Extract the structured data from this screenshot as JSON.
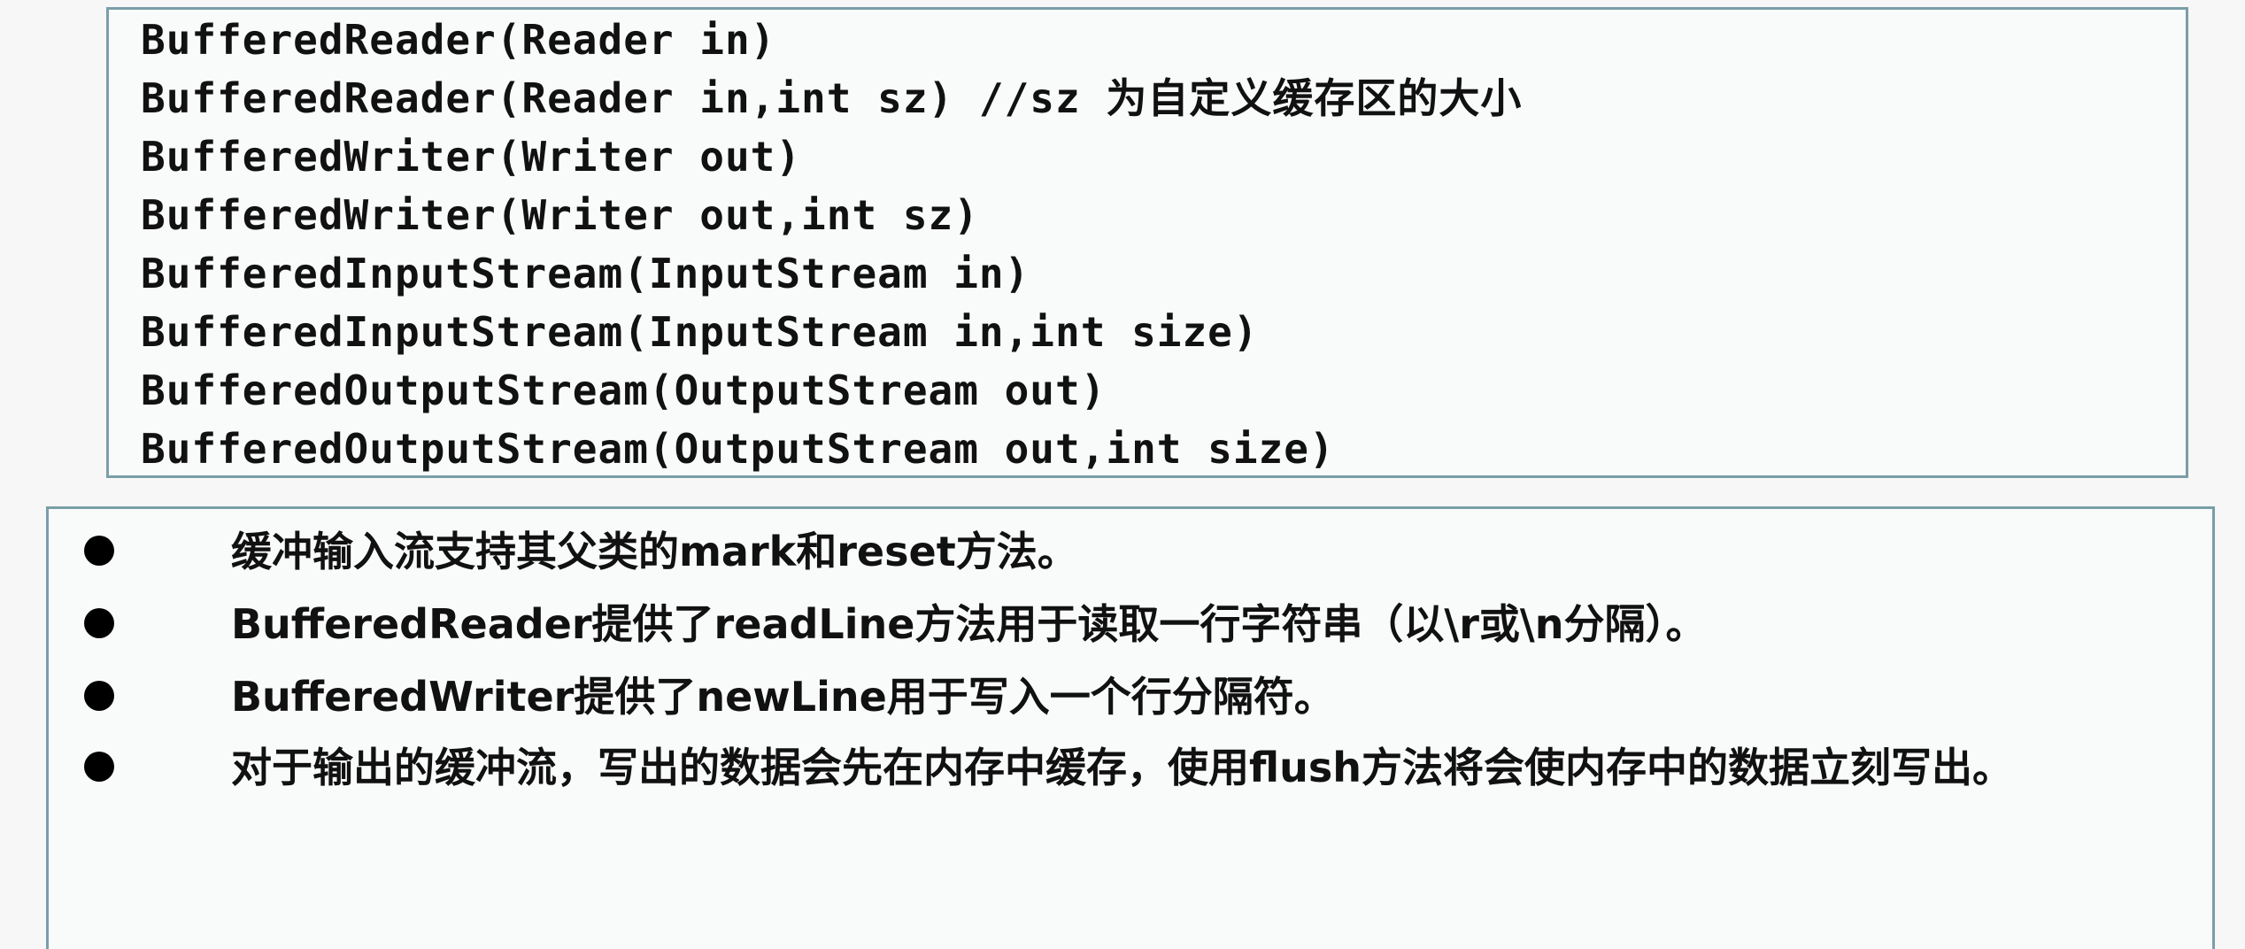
{
  "code_lines": [
    "BufferedReader(Reader in)",
    "BufferedReader(Reader in,int sz) //sz 为自定义缓存区的大小",
    "BufferedWriter(Writer out)",
    "BufferedWriter(Writer out,int sz)",
    "BufferedInputStream(InputStream in)",
    "BufferedInputStream(InputStream in,int size)",
    "BufferedOutputStream(OutputStream out)",
    "BufferedOutputStream(OutputStream out,int size)"
  ],
  "notes": [
    "缓冲输入流支持其父类的mark和reset方法。",
    "BufferedReader提供了readLine方法用于读取一行字符串（以\\r或\\n分隔）。",
    "BufferedWriter提供了newLine用于写入一个行分隔符。",
    "对于输出的缓冲流，写出的数据会先在内存中缓存，使用flush方法将会使内存中的数据立刻写出。"
  ]
}
